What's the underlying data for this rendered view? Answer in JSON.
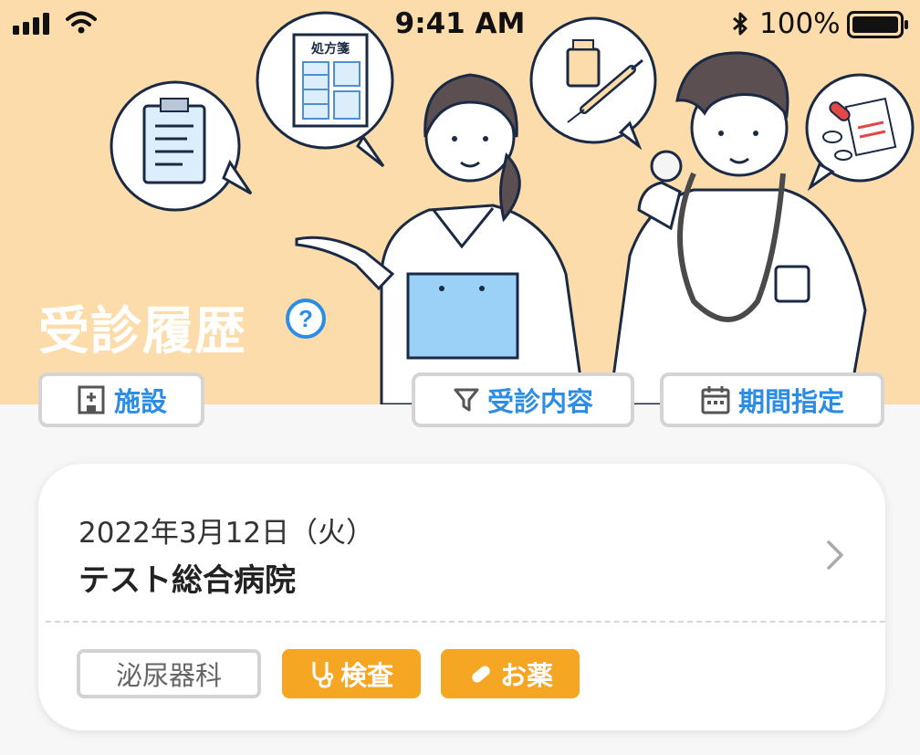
{
  "status_bar": {
    "time": "9:41 AM",
    "battery_percent": "100%"
  },
  "header": {
    "title": "受診履歴",
    "help_icon": "question-circle-icon",
    "illustration_prescription_label": "処方箋"
  },
  "filters": [
    {
      "label": "施設",
      "icon": "hospital-building-icon"
    },
    {
      "label": "受診内容",
      "icon": "filter-funnel-icon"
    },
    {
      "label": "期間指定",
      "icon": "calendar-icon"
    }
  ],
  "visit": {
    "date": "2022年3月12日（火）",
    "hospital": "テスト総合病院",
    "department": "泌尿器科",
    "tags": [
      {
        "label": "検査",
        "icon": "stethoscope-icon"
      },
      {
        "label": "お薬",
        "icon": "pill-icon"
      }
    ]
  },
  "colors": {
    "hero_background": "#fddcab",
    "accent_blue": "#2c8de6",
    "tag_orange": "#f5a623"
  }
}
